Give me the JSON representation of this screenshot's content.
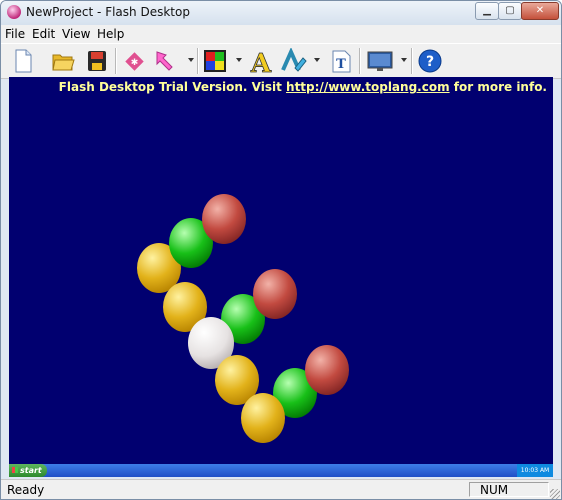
{
  "window": {
    "title": "NewProject - Flash Desktop"
  },
  "title_buttons": {
    "minimize": "▁",
    "maximize": "▢",
    "close": "✕"
  },
  "menu": [
    "File",
    "Edit",
    "View",
    "Help"
  ],
  "toolbar": {
    "icons": [
      "new-document-icon",
      "open-folder-icon",
      "save-disk-icon",
      "effects-icon",
      "arrow-tool-icon",
      "color-palette-icon",
      "text-font-icon",
      "text-effect-icon",
      "insert-text-icon",
      "screen-preview-icon",
      "help-icon"
    ],
    "help_glyph": "?",
    "font_glyph": "A",
    "insert_text_glyph": "T"
  },
  "content": {
    "background": "#010070",
    "banner_prefix": "Flash Desktop Trial Version. Visit ",
    "banner_link": "http://www.toplang.com",
    "banner_suffix": " for more info."
  },
  "taskbar": {
    "start_label": "start",
    "clock": "10:03 AM"
  },
  "status": {
    "text": "Ready",
    "indicator": "NUM"
  }
}
